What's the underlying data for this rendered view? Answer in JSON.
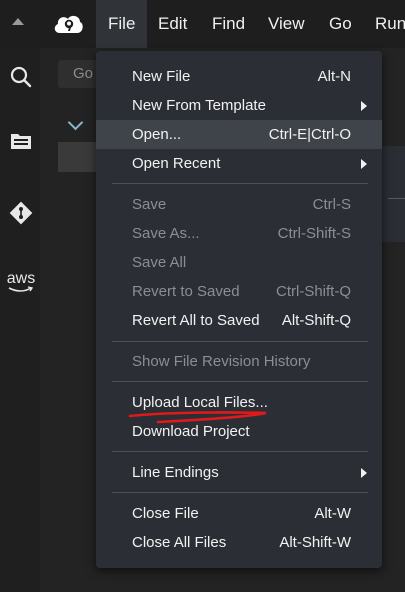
{
  "menubar": {
    "items": [
      {
        "label": "File"
      },
      {
        "label": "Edit"
      },
      {
        "label": "Find"
      },
      {
        "label": "View"
      },
      {
        "label": "Go"
      },
      {
        "label": "Run"
      }
    ],
    "active_item": "File"
  },
  "sidebar": {
    "icons": [
      "search-icon",
      "folder-icon",
      "git-icon",
      "aws-icon"
    ],
    "aws_label": "aws"
  },
  "background": {
    "search_placeholder": "Go"
  },
  "file_menu": {
    "items": [
      {
        "label": "New File",
        "shortcut": "Alt-N"
      },
      {
        "label": "New From Template",
        "shortcut": ""
      },
      {
        "label": "Open...",
        "shortcut": "Ctrl-E|Ctrl-O"
      },
      {
        "label": "Open Recent",
        "shortcut": ""
      },
      {
        "label": "Save",
        "shortcut": "Ctrl-S"
      },
      {
        "label": "Save As...",
        "shortcut": "Ctrl-Shift-S"
      },
      {
        "label": "Save All",
        "shortcut": ""
      },
      {
        "label": "Revert to Saved",
        "shortcut": "Ctrl-Shift-Q"
      },
      {
        "label": "Revert All to Saved",
        "shortcut": "Alt-Shift-Q"
      },
      {
        "label": "Show File Revision History",
        "shortcut": ""
      },
      {
        "label": "Upload Local Files...",
        "shortcut": ""
      },
      {
        "label": "Download Project",
        "shortcut": ""
      },
      {
        "label": "Line Endings",
        "shortcut": ""
      },
      {
        "label": "Close File",
        "shortcut": "Alt-W"
      },
      {
        "label": "Close All Files",
        "shortcut": "Alt-Shift-W"
      }
    ]
  },
  "colors": {
    "menubar_bg": "#1e1e1e",
    "dropdown_bg": "#2b2e34",
    "highlight_bg": "#3f434a",
    "disabled_text": "#8b8e94",
    "annotation_red": "#e0191b"
  }
}
